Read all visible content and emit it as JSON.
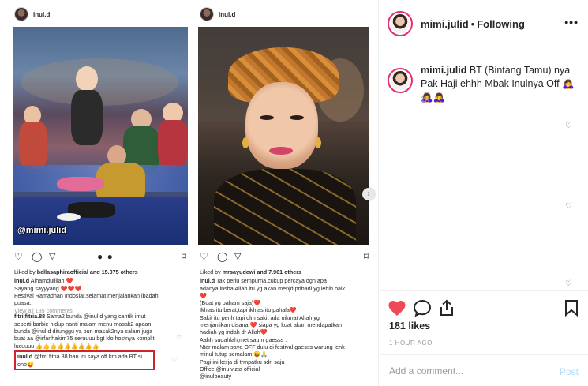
{
  "left_post": {
    "username": "inul.d",
    "watermark": "@mimi.julid",
    "liked_by_prefix": "Liked by ",
    "liked_by_user": "bellasaphiraofficial",
    "liked_by_suffix": " and 15.075 others",
    "caption_user": "inul.d",
    "caption_lines": [
      "Alhamdulillah ❤️",
      "Sayang sayyyang ❤️❤️❤️",
      "Festival Ramadhan Indosiar,selamat menjalankan ibadah",
      "puasa."
    ],
    "view_all": "View all 185 comments",
    "comment1_user": "fitri.fitria.88",
    "comment1_lines": [
      "Sama2 bunda @inul.d yang cantik imut",
      "seperti barbie hidup nanti malam menu masak2 apaan",
      "bunda @inul.d ditunggu ya bun masak2nya salam juga",
      "buat aa @irfanhakim75 seruuuu bgt klo hostnya komplit",
      "lucuuuu 👍👍👍👍👍👍👍👍👍"
    ],
    "reply_user": "inul.d",
    "reply_line1": "@fitri.fitria.88 hari ini saya off krn ada BT si",
    "reply_line2": "ono😜"
  },
  "right_post": {
    "username": "inul.d",
    "liked_by_prefix": "Liked by ",
    "liked_by_user": "mrsayudewi",
    "liked_by_suffix": " and 7.961 others",
    "caption_user": "inul.d",
    "caption_lines": [
      "Tak perlu sempurna,cukup percaya dgn apa",
      "adanya,insha Allah itu yg akan menjd pribadi yg lebih baik",
      "❤️",
      "(Buat yg paham saja)❤️",
      "Ikhlas itu berat,tapi ikhlas itu pahala❤️",
      "Sakit itu perih tapi dlm sakit ada nikmat Allah yg",
      "menjanjikan disana.❤️ siapa yg kuat akan mendapatkan",
      "hadiah yg indah dr Allah❤️",
      "Aahh sudahlah,met saum gaesss .",
      "Ntar malam saya OFF dulu di festival gaesss warung jenk",
      "minul tutup semalam.😜🙏",
      "Pagi ini kerja di trmpatku sdri saja .",
      "Office @inulvizta official",
      "@inulbeauty"
    ]
  },
  "sidebar": {
    "username": "mimi.julid",
    "dot": "•",
    "follow_status": "Following",
    "more_icon": "•••",
    "caption_user": "mimi.julid",
    "caption_text": "BT (Bintang Tamu) nya Pak Haji ehhh Mbak Inulnya Off 🙇‍♀️🙇‍♀️🙇‍♀️",
    "caption_time": "1h",
    "likes": "181 likes",
    "time_ago": "1 HOUR AGO",
    "add_comment_placeholder": "Add a comment...",
    "post_label": "Post"
  },
  "colors": {
    "like_red": "#ed4956",
    "post_blue_disabled": "#b2dffc",
    "highlight_red": "#d0242b",
    "story_ring": "#e1306c"
  },
  "icons": {
    "like": "heart-filled-icon",
    "comment": "comment-bubble-icon",
    "share": "share-upload-icon",
    "save": "bookmark-icon",
    "more": "more-horizontal-icon",
    "carousel": "chevron-right-icon"
  }
}
